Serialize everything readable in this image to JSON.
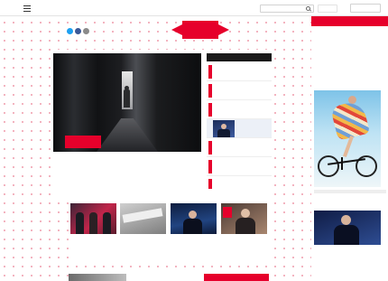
{
  "colors": {
    "brand": "#e6002b",
    "dark": "#1a1a1a",
    "page_dots": "#f1a8b6"
  },
  "topbar": {
    "menu_label": "",
    "search_placeholder": "",
    "counter": "",
    "subscribe": ""
  },
  "header": {
    "social_label": "",
    "social_icons": [
      "twitter-icon",
      "facebook-icon",
      "instagram-icon"
    ],
    "logo": ""
  },
  "hero": {
    "badge": "",
    "tag": "",
    "title": "",
    "lead": ""
  },
  "fil": {
    "title": "",
    "items": [
      {
        "num": "",
        "text": ""
      },
      {
        "num": "",
        "text": ""
      },
      {
        "num": "",
        "text": ""
      },
      {
        "num": "",
        "text": ""
      },
      {
        "num": "",
        "text": ""
      },
      {
        "num": "",
        "text": ""
      },
      {
        "num": "",
        "text": ""
      }
    ]
  },
  "cards": [
    {
      "category": "",
      "text": ""
    },
    {
      "category": "",
      "text": ""
    },
    {
      "category": "",
      "text": ""
    },
    {
      "category": "",
      "text": ""
    }
  ],
  "right": {
    "head": "",
    "intro": "",
    "intro_more": "",
    "photo_category": "",
    "photo_text": "",
    "bottom_link": ""
  }
}
